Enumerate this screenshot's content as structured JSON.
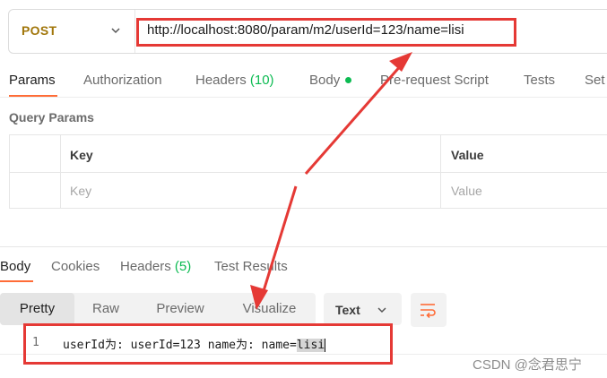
{
  "request": {
    "method": "POST",
    "url": "http://localhost:8080/param/m2/userId=123/name=lisi"
  },
  "request_tabs": [
    {
      "label": "Params"
    },
    {
      "label": "Authorization"
    },
    {
      "label": "Headers",
      "count": "(10)"
    },
    {
      "label": "Body"
    },
    {
      "label": "Pre-request Script"
    },
    {
      "label": "Tests"
    },
    {
      "label": "Set"
    }
  ],
  "query_params": {
    "title": "Query Params",
    "headers": [
      "Key",
      "Value"
    ],
    "placeholders": [
      "Key",
      "Value"
    ]
  },
  "response_tabs": [
    {
      "label": "Body"
    },
    {
      "label": "Cookies"
    },
    {
      "label": "Headers",
      "count": "(5)"
    },
    {
      "label": "Test Results"
    }
  ],
  "view_modes": [
    "Pretty",
    "Raw",
    "Preview",
    "Visualize"
  ],
  "format_select": "Text",
  "response_body": {
    "line_number": "1",
    "text_prefix": "userId为: userId=123 name为: name=",
    "text_highlight": "lisi"
  },
  "watermark": "CSDN @念君思宁",
  "colors": {
    "method": "#a1760a",
    "accent": "#ff6c37",
    "count_green": "#0cbb52",
    "annotation_red": "#e53935"
  }
}
